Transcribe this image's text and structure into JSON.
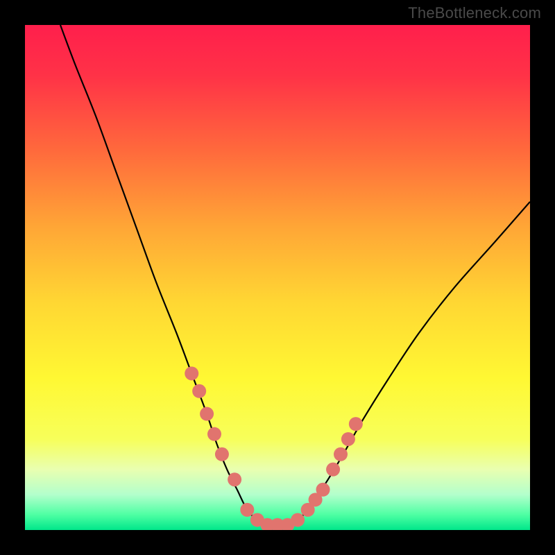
{
  "watermark": "TheBottleneck.com",
  "colors": {
    "gradient_stops": [
      {
        "offset": 0.0,
        "color": "#ff1f4c"
      },
      {
        "offset": 0.1,
        "color": "#ff3247"
      },
      {
        "offset": 0.25,
        "color": "#ff6a3c"
      },
      {
        "offset": 0.4,
        "color": "#ffa636"
      },
      {
        "offset": 0.55,
        "color": "#ffd733"
      },
      {
        "offset": 0.7,
        "color": "#fff833"
      },
      {
        "offset": 0.82,
        "color": "#f7ff5a"
      },
      {
        "offset": 0.88,
        "color": "#e9ffb0"
      },
      {
        "offset": 0.93,
        "color": "#b3ffcc"
      },
      {
        "offset": 0.97,
        "color": "#4dffa3"
      },
      {
        "offset": 1.0,
        "color": "#00e68a"
      }
    ],
    "curve": "#000000",
    "marker": "#e1746e",
    "frame": "#000000"
  },
  "chart_data": {
    "type": "line",
    "title": "",
    "xlabel": "",
    "ylabel": "",
    "xlim": [
      0,
      100
    ],
    "ylim": [
      0,
      100
    ],
    "series": [
      {
        "name": "bottleneck-curve",
        "x": [
          7,
          10,
          14,
          18,
          22,
          26,
          30,
          33,
          36,
          38,
          40,
          42,
          44,
          46,
          48,
          50,
          52,
          54,
          56,
          58,
          60,
          63,
          67,
          72,
          78,
          85,
          93,
          100
        ],
        "y": [
          100,
          92,
          82,
          71,
          60,
          49,
          39,
          31,
          23,
          17,
          12,
          8,
          4,
          2,
          1,
          1,
          1,
          2,
          4,
          7,
          10,
          15,
          22,
          30,
          39,
          48,
          57,
          65
        ]
      }
    ],
    "markers": {
      "name": "highlighted-points",
      "x": [
        33,
        34.5,
        36,
        37.5,
        39,
        41.5,
        44,
        46,
        48,
        50,
        52,
        54,
        56,
        57.5,
        59,
        61,
        62.5,
        64,
        65.5
      ],
      "y": [
        31,
        27.5,
        23,
        19,
        15,
        10,
        4,
        2,
        1,
        1,
        1,
        2,
        4,
        6,
        8,
        12,
        15,
        18,
        21
      ]
    }
  }
}
